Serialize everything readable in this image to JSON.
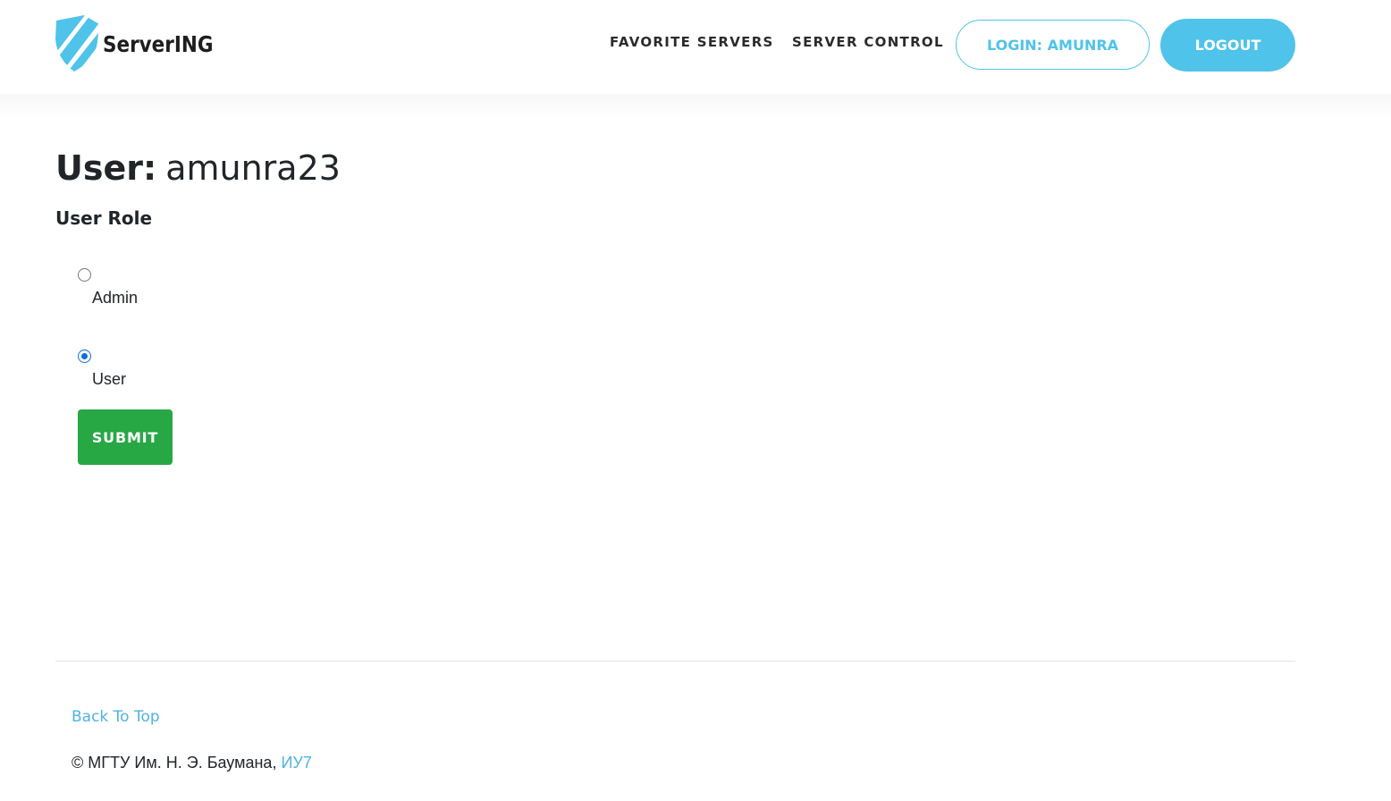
{
  "header": {
    "logo_text": "ServerING",
    "nav": {
      "favorite_servers": "FAVORITE SERVERS",
      "server_control": "SERVER CONTROL"
    },
    "login_button": "LOGIN: AMUNRA",
    "logout_button": "LOGOUT"
  },
  "main": {
    "title_label": "User:",
    "title_value": "amunra23",
    "section_title": "User Role",
    "roles": [
      {
        "label": "Admin",
        "checked": false
      },
      {
        "label": "User",
        "checked": true
      }
    ],
    "submit_label": "SUBMIT"
  },
  "footer": {
    "back_to_top": "Back To Top",
    "copyright_text": "© МГТУ Им. Н. Э. Баумана, ",
    "copyright_link": "ИУ7"
  },
  "colors": {
    "accent": "#4fc3ea",
    "submit": "#28a745",
    "radio_checked": "#0b6fd6"
  },
  "icons": {
    "logo": "shield-icon"
  }
}
